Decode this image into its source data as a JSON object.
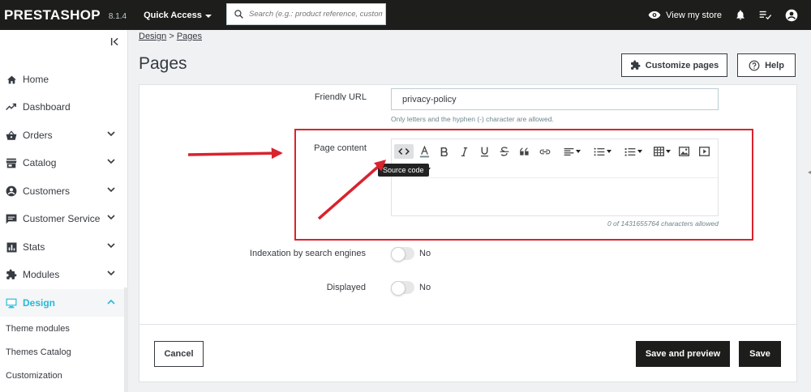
{
  "header": {
    "logo": "PRESTASHOP",
    "version": "8.1.4",
    "quick_access": "Quick Access",
    "search_placeholder": "Search (e.g.: product reference, customer name...)",
    "view_store": "View my store"
  },
  "sidebar": {
    "items": [
      {
        "label": "Home",
        "icon": "home-icon"
      },
      {
        "label": "Dashboard",
        "icon": "trending-up-icon"
      },
      {
        "label": "Orders",
        "icon": "basket-icon"
      },
      {
        "label": "Catalog",
        "icon": "store-icon"
      },
      {
        "label": "Customers",
        "icon": "account-circle-icon"
      },
      {
        "label": "Customer Service",
        "icon": "chat-icon"
      },
      {
        "label": "Stats",
        "icon": "bar-chart-icon"
      },
      {
        "label": "Modules",
        "icon": "puzzle-icon"
      },
      {
        "label": "Design",
        "icon": "desktop-icon"
      }
    ],
    "sub_items": [
      "Theme modules",
      "Themes Catalog",
      "Customization"
    ]
  },
  "breadcrumb": {
    "parent": "Design",
    "separator": ">",
    "current": "Pages"
  },
  "page": {
    "title": "Pages",
    "customize_label": "Customize pages",
    "help_label": "Help"
  },
  "form": {
    "friendly_url_label": "Friendly URL",
    "friendly_url_value": "privacy-policy",
    "friendly_url_help": "Only letters and the hyphen (-) character are allowed.",
    "page_content_label": "Page content",
    "tooltip": "Source code",
    "char_count": "0 of 1431655764 characters allowed",
    "indexation_label": "Indexation by search engines",
    "indexation_value": "No",
    "displayed_label": "Displayed",
    "displayed_value": "No"
  },
  "footer": {
    "cancel": "Cancel",
    "save_preview": "Save and preview",
    "save": "Save"
  },
  "colors": {
    "header_bg": "#1d1d1b",
    "accent": "#25b9d7",
    "highlight": "#d9232e"
  }
}
